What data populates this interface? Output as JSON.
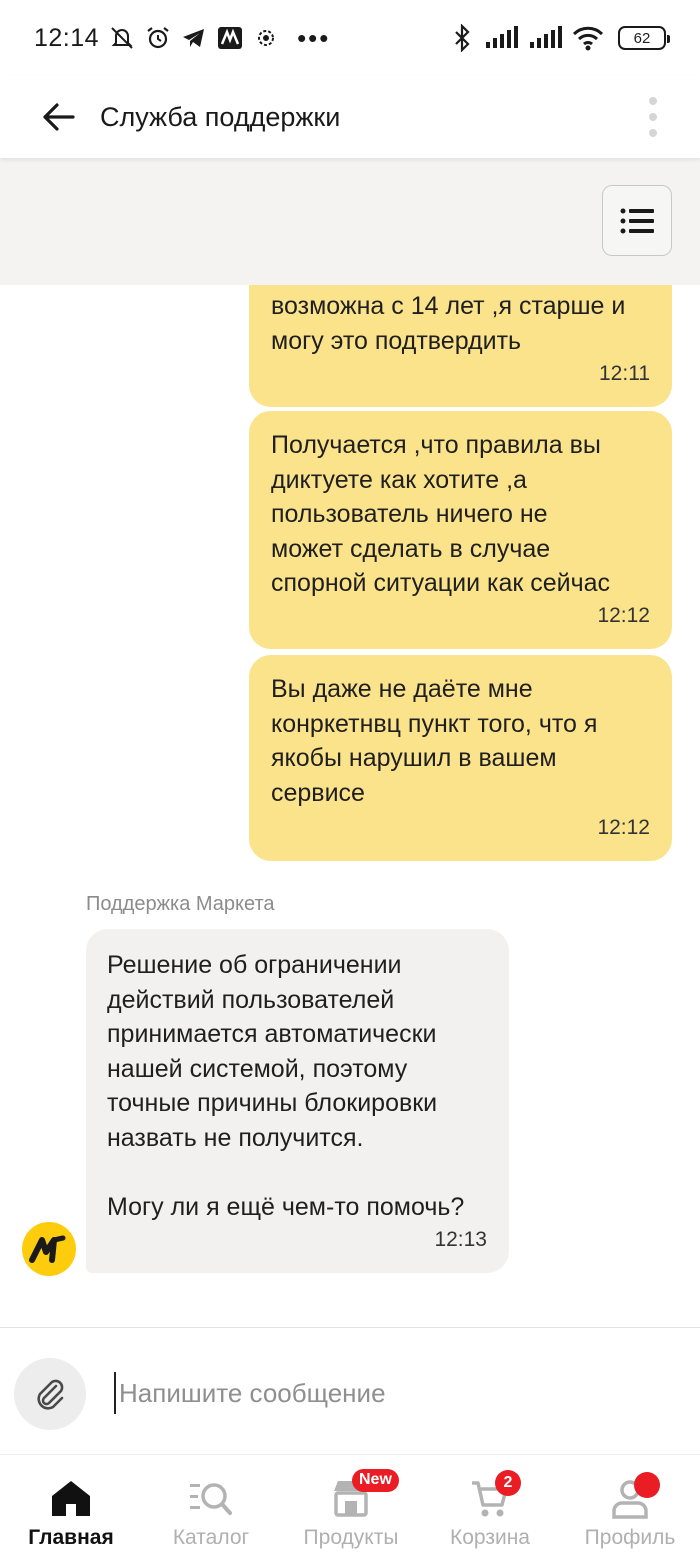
{
  "status_bar": {
    "time": "12:14",
    "battery": "62"
  },
  "header": {
    "title": "Служба поддержки"
  },
  "messages": [
    {
      "text": "возможна с 14 лет ,я старше и\nмогу это подтвердить",
      "time": "12:11"
    },
    {
      "text": "Получается ,что правила вы\nдиктуете как хотите ,а\nпользователь ничего не\nможет сделать в случае\nспорной ситуации как сейчас",
      "time": "12:12"
    },
    {
      "text": "Вы даже не даёте мне\nконркетнвц пункт того, что я\nякобы нарушил в вашем\nсервисе",
      "time": "12:12"
    }
  ],
  "support": {
    "sender": "Поддержка Маркета",
    "text": "Решение об ограничении\nдействий пользователей\nпринимается автоматически\nнашей системой, поэтому\nточные причины блокировки\nназвать не получится.\n\nМогу ли я ещё чем-то помочь?",
    "time": "12:13"
  },
  "composer": {
    "placeholder": "Напишите сообщение",
    "value": ""
  },
  "nav": {
    "items": [
      {
        "label": "Главная",
        "icon": "home-icon",
        "active": true
      },
      {
        "label": "Каталог",
        "icon": "catalog-search-icon"
      },
      {
        "label": "Продукты",
        "icon": "store-icon",
        "badge": "New"
      },
      {
        "label": "Корзина",
        "icon": "cart-icon",
        "badge": "2"
      },
      {
        "label": "Профиль",
        "icon": "profile-icon"
      }
    ]
  },
  "colors": {
    "outgoing_bubble": "#fbe38b",
    "incoming_bubble": "#f2f1ef",
    "badge_red": "#ea1c24",
    "brand_yellow": "#fccc0d"
  }
}
